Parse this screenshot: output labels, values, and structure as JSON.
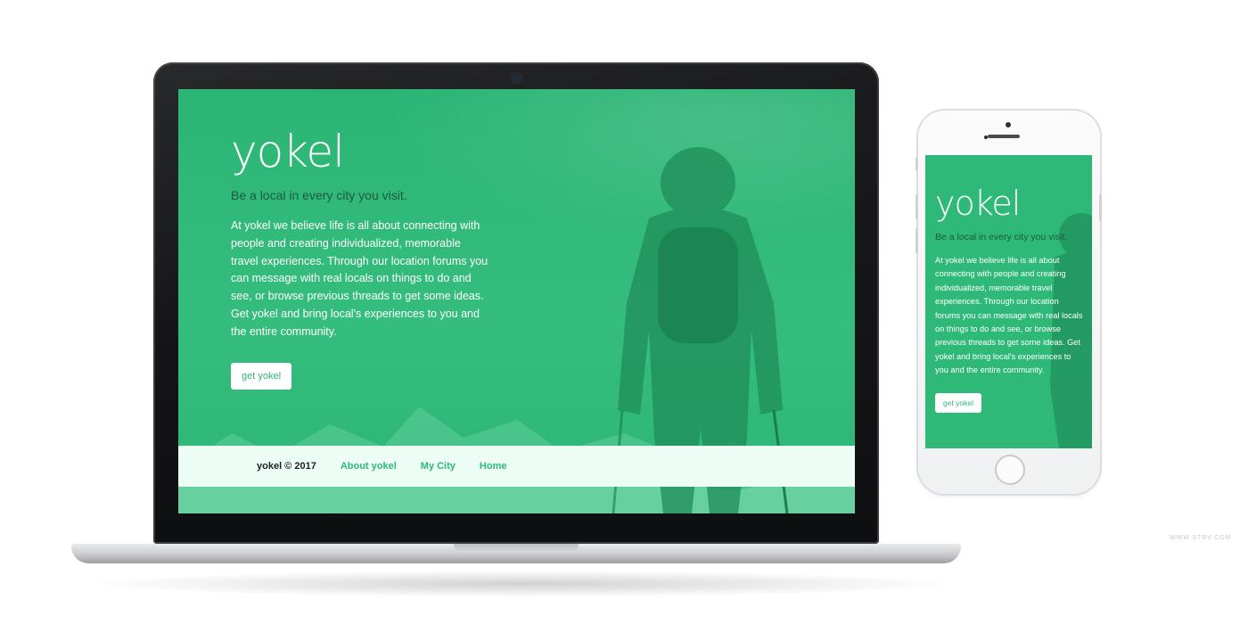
{
  "brand": "yokel",
  "tagline": "Be a local in every city you visit.",
  "about": "At yokel we believe life is all about connecting with people and creating individualized, memorable travel experiences. Through our location forums you can message with real locals on things to do and see, or browse previous threads to get some ideas. Get yokel and bring local's experiences to you and the entire community.",
  "cta_label": "get yokel",
  "footer": {
    "copyright": "yokel © 2017",
    "links": [
      "About yokel",
      "My City",
      "Home"
    ]
  },
  "watermark": "WWW.STRV.COM",
  "colors": {
    "accent": "#2fb978",
    "footer_bg": "#ecfdf6",
    "tagline": "#1d5a3d"
  }
}
